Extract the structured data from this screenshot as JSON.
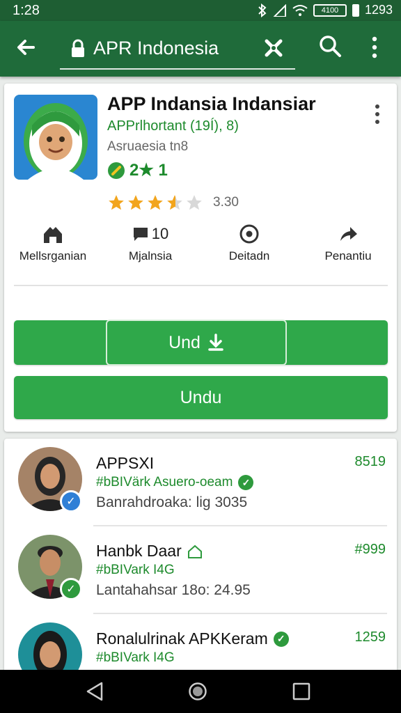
{
  "status": {
    "time": "1:28",
    "battery_box": "4100",
    "battery_pct": "1293"
  },
  "toolbar": {
    "url": "APR Indonesia"
  },
  "app": {
    "title": "APP Indansia Indansiar",
    "developer": "APPrlhortant (19Í), 8)",
    "category": "Asruaesia tn8",
    "badge_text": "2★ 1",
    "rating_value": 3.5,
    "rating_text": "3.30",
    "actions": [
      {
        "label": "Mellsrganian",
        "icon": "house-icon",
        "number": ""
      },
      {
        "label": "Mjalnsia",
        "icon": "chat-icon",
        "number": "10"
      },
      {
        "label": "Deitadn",
        "icon": "info-circle-icon",
        "number": ""
      },
      {
        "label": "Penantiu",
        "icon": "share-icon",
        "number": ""
      }
    ],
    "install_label": "Und",
    "install2_label": "Undu"
  },
  "list": [
    {
      "name": "APPSXI",
      "sub": "#bBIVärk Asuero-oeam",
      "desc": "Banrahdroaka: lig 3035",
      "price": "8519",
      "badge_color": "#2f7fd6",
      "avatar_bg": "#8b6f5a"
    },
    {
      "name": "Hanbk Daar",
      "sub": "#bBIVark I4G",
      "desc": "Lantahahsar 18o: 24.95",
      "price": "#999",
      "badge_color": "#2e9a3d",
      "avatar_bg": "#6f8a63"
    },
    {
      "name": "Ronalulrinak APKKeram",
      "sub": "#bBIVark I4G",
      "desc": "",
      "price": "1259",
      "badge_color": "#2e9a3d",
      "avatar_bg": "#1e8f98"
    }
  ],
  "colors": {
    "appbar": "#1f6b3a",
    "accent": "#2fa84a",
    "green_text": "#1d8a2c"
  }
}
